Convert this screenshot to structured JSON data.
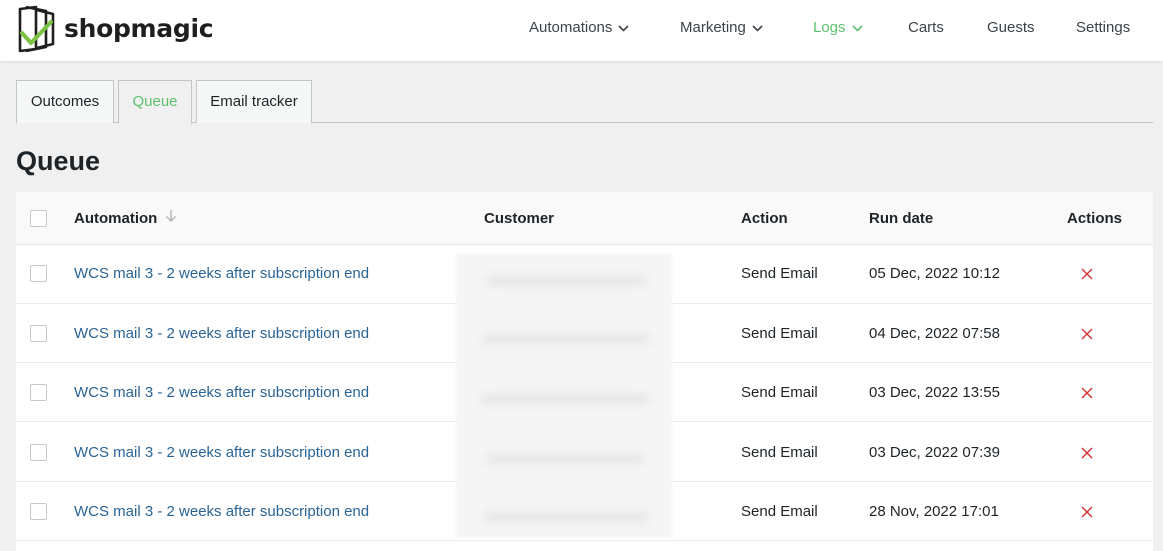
{
  "brand": {
    "name": "shopmagic"
  },
  "nav": {
    "items": [
      {
        "label": "Automations",
        "dropdown": true,
        "active": false
      },
      {
        "label": "Marketing",
        "dropdown": true,
        "active": false
      },
      {
        "label": "Logs",
        "dropdown": true,
        "active": true
      },
      {
        "label": "Carts",
        "dropdown": false,
        "active": false
      },
      {
        "label": "Guests",
        "dropdown": false,
        "active": false
      },
      {
        "label": "Settings",
        "dropdown": false,
        "active": false
      }
    ]
  },
  "tabs": [
    {
      "label": "Outcomes",
      "active": false
    },
    {
      "label": "Queue",
      "active": true
    },
    {
      "label": "Email tracker",
      "active": false
    }
  ],
  "page": {
    "title": "Queue"
  },
  "table": {
    "columns": {
      "automation": "Automation",
      "customer": "Customer",
      "action": "Action",
      "run_date": "Run date",
      "actions": "Actions"
    },
    "rows": [
      {
        "automation": "WCS mail 3 - 2 weeks after subscription end",
        "customer": "",
        "action": "Send Email",
        "run_date": "05 Dec, 2022 10:12"
      },
      {
        "automation": "WCS mail 3 - 2 weeks after subscription end",
        "customer": "",
        "action": "Send Email",
        "run_date": "04 Dec, 2022 07:58"
      },
      {
        "automation": "WCS mail 3 - 2 weeks after subscription end",
        "customer": "",
        "action": "Send Email",
        "run_date": "03 Dec, 2022 13:55"
      },
      {
        "automation": "WCS mail 3 - 2 weeks after subscription end",
        "customer": "",
        "action": "Send Email",
        "run_date": "03 Dec, 2022 07:39"
      },
      {
        "automation": "WCS mail 3 - 2 weeks after subscription end",
        "customer": "",
        "action": "Send Email",
        "run_date": "28 Nov, 2022 17:01"
      }
    ]
  },
  "colors": {
    "accent": "#5ec16e",
    "link": "#2a6496",
    "delete": "#d63638",
    "background": "#f0f0f1"
  },
  "icons": {
    "logo": "shopmagic-logo-icon",
    "dropdown": "chevron-down-icon",
    "sort": "arrow-down-icon",
    "delete": "close-icon",
    "checkbox": "checkbox-icon"
  }
}
